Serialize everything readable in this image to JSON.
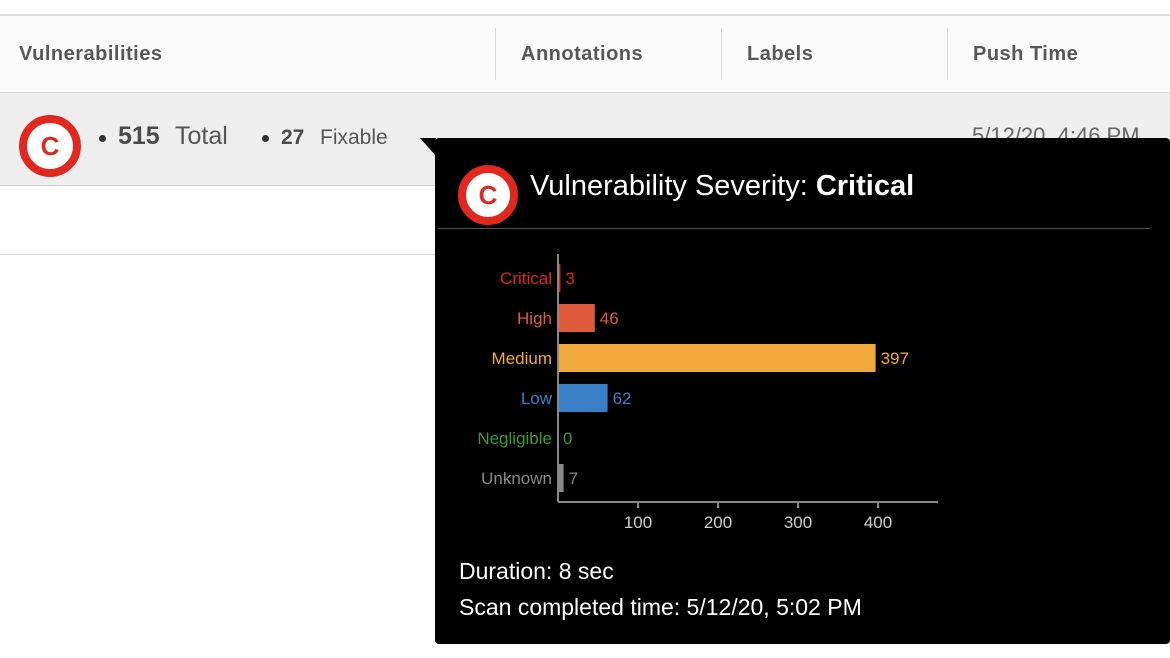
{
  "table": {
    "columns": [
      "Vulnerabilities",
      "Annotations",
      "Labels",
      "Push Time"
    ],
    "row": {
      "severity_badge": "C",
      "total_count": "515",
      "total_label": "Total",
      "fixable_count": "27",
      "fixable_label": "Fixable",
      "push_time": "5/12/20, 4:46 PM"
    }
  },
  "tooltip": {
    "badge": "C",
    "title_prefix": "Vulnerability Severity:",
    "title_value": "Critical",
    "duration": "Duration: 8 sec",
    "scan_completed": "Scan completed time: 5/12/20, 5:02 PM"
  },
  "chart_data": {
    "type": "bar",
    "orientation": "horizontal",
    "categories": [
      "Critical",
      "High",
      "Medium",
      "Low",
      "Negligible",
      "Unknown"
    ],
    "values": [
      3,
      46,
      397,
      62,
      0,
      7
    ],
    "colors": [
      "#e0281e",
      "#e05a3c",
      "#f2a93b",
      "#3a7fc6",
      "#3c9a2e",
      "#888888"
    ],
    "xticks": [
      100,
      200,
      300,
      400
    ],
    "xlim": [
      0,
      475
    ],
    "grid": false
  },
  "colors": {
    "critical": "#e0281e",
    "tooltip_bg": "#000000",
    "row_bg": "#eeeeee"
  }
}
